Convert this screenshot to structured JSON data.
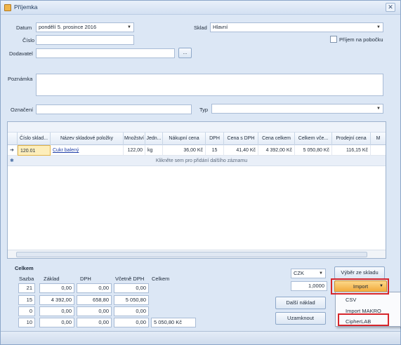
{
  "window": {
    "title": "Příjemka",
    "close_glyph": "✕"
  },
  "header": {
    "datum_label": "Datum",
    "datum_value": "pondělí 5. prosince 2016",
    "sklad_label": "Sklad",
    "sklad_value": "Hlavní",
    "cislo_label": "Číslo",
    "cislo_value": "",
    "prijem_label": "Příjem na pobočku",
    "prijem_checked": false,
    "dodavatel_label": "Dodavatel",
    "dodavatel_value": "",
    "browse_label": "...",
    "poznamka_label": "Poznámka",
    "poznamka_value": "",
    "oznaceni_label": "Označení",
    "oznaceni_value": "",
    "typ_label": "Typ",
    "typ_value": ""
  },
  "grid": {
    "columns": [
      "Číslo sklad...",
      "Název skladové položky",
      "Množství",
      "Jedn...",
      "Nákupní cena",
      "DPH",
      "Cena s DPH",
      "Cena celkem",
      "Celkem vče...",
      "Prodejní cena",
      "M"
    ],
    "row": {
      "indicator": "➔",
      "cells": [
        "120.01",
        "Cukr balený",
        "122,00",
        "kg",
        "36,00 Kč",
        "15",
        "41,40 Kč",
        "4 392,00 Kč",
        "5 050,80 Kč",
        "116,15 Kč",
        ""
      ]
    },
    "new_row_indicator": "✱",
    "new_row_text": "Klikněte sem pro přidání dalšího záznamu"
  },
  "summary": {
    "title": "Celkem",
    "headers": [
      "Sazba",
      "Základ",
      "DPH",
      "Včetně DPH",
      "Celkem"
    ],
    "rows": [
      {
        "sazba": "21",
        "zaklad": "0,00",
        "dph": "0,00",
        "vcetne": "0,00"
      },
      {
        "sazba": "15",
        "zaklad": "4 392,00",
        "dph": "658,80",
        "vcetne": "5 050,80"
      },
      {
        "sazba": "0",
        "zaklad": "0,00",
        "dph": "0,00",
        "vcetne": "0,00"
      },
      {
        "sazba": "10",
        "zaklad": "0,00",
        "dph": "0,00",
        "vcetne": "0,00"
      }
    ],
    "celkem_value": "5 050,80 Kč"
  },
  "currency": {
    "value": "CZK",
    "rate": "1,0000"
  },
  "buttons": {
    "vyber": "Výběr ze skladu",
    "import": "Import",
    "dalsi": "Další náklad",
    "uzamknout": "Uzamknout"
  },
  "import_menu": {
    "items": [
      "CSV",
      "Import MAKRO",
      "CipherLAB"
    ]
  },
  "colors": {
    "window_bg": "#dce7f5",
    "import_button": "#f5b041",
    "highlight": "#d6262b"
  }
}
